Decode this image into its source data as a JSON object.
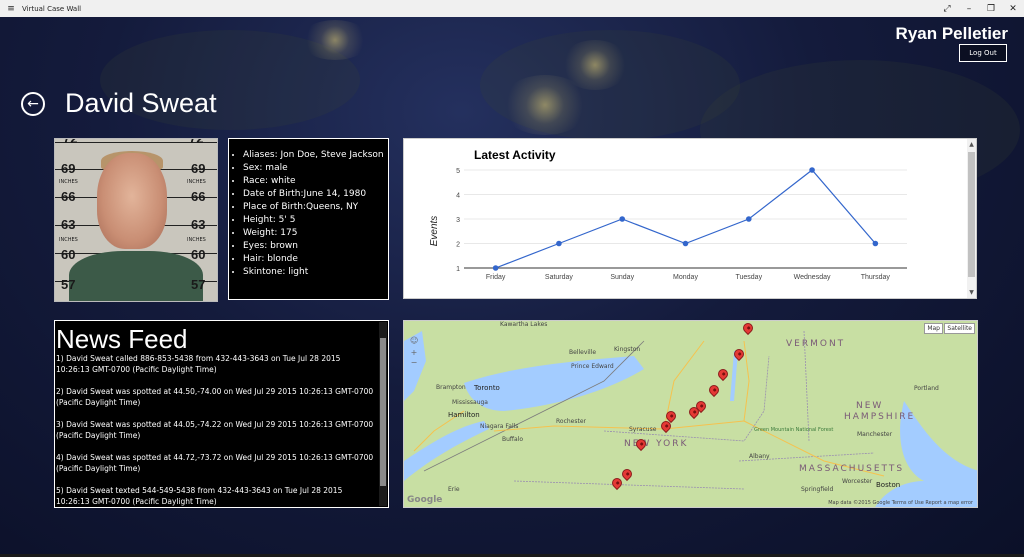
{
  "window": {
    "title": "Virtual Case Wall",
    "menu_icon": "hamburger-icon",
    "controls": [
      "expand-icon",
      "minimize-icon",
      "restore-icon",
      "close-icon"
    ]
  },
  "user": {
    "name": "Ryan Pelletier",
    "logout_label": "Log Out"
  },
  "header": {
    "back_icon": "back-arrow-icon",
    "title": "David Sweat"
  },
  "mugshot": {
    "ruler_numbers": [
      "72",
      "69",
      "66",
      "63",
      "60",
      "57"
    ],
    "ruler_sub": "INCHES"
  },
  "bio": {
    "items": [
      "Aliases: Jon Doe, Steve Jackson",
      "Sex: male",
      "Race: white",
      "Date of Birth:June 14, 1980",
      "Place of Birth:Queens, NY",
      "Height: 5' 5",
      "Weight: 175",
      "Eyes: brown",
      "Hair: blonde",
      "Skintone: light"
    ]
  },
  "chart_data": {
    "type": "line",
    "title": "Latest Activity",
    "xlabel": "",
    "ylabel": "Events",
    "categories": [
      "Friday",
      "Saturday",
      "Sunday",
      "Monday",
      "Tuesday",
      "Wednesday",
      "Thursday"
    ],
    "series": [
      {
        "values": [
          1,
          2,
          3,
          2,
          3,
          5,
          2
        ]
      }
    ],
    "ylim": [
      1,
      5
    ],
    "yticks": [
      1,
      2,
      3,
      4,
      5
    ],
    "grid": true,
    "color": "#3366cc"
  },
  "news": {
    "title": "News Feed",
    "items": [
      "1) David Sweat called 886-853-5438 from 432-443-3643 on Tue Jul 28 2015 10:26:13 GMT-0700 (Pacific Daylight Time)",
      "2) David Sweat was spotted at 44.50,-74.00 on Wed Jul 29 2015 10:26:13 GMT-0700 (Pacific Daylight Time)",
      "3) David Sweat was spotted at 44.05,-74.22 on Wed Jul 29 2015 10:26:13 GMT-0700 (Pacific Daylight Time)",
      "4) David Sweat was spotted at 44.72,-73.72 on Wed Jul 29 2015 10:26:13 GMT-0700 (Pacific Daylight Time)",
      "5) David Sweat texted 544-549-5438 from 432-443-3643 on Tue Jul 28 2015 10:26:13 GMT-0700 (Pacific Daylight Time)"
    ]
  },
  "map": {
    "map_button": "Map",
    "satellite_button": "Satellite",
    "google_logo": "Google",
    "footer": "Map data ©2015 Google   Terms of Use   Report a map error",
    "labels": {
      "kawartha": "Kawartha Lakes",
      "belleville": "Belleville",
      "prince_edward": "Prince Edward",
      "kingston": "Kingston",
      "brampton": "Brampton",
      "toronto": "Toronto",
      "mississauga": "Mississauga",
      "hamilton": "Hamilton",
      "niagara": "Niagara Falls",
      "buffalo": "Buffalo",
      "rochester": "Rochester",
      "syracuse": "Syracuse",
      "albany": "Albany",
      "erie": "Erie",
      "springfield": "Springfield",
      "worcester": "Worcester",
      "boston": "Boston",
      "manchester": "Manchester",
      "portland": "Portland",
      "green_mountain": "Green Mountain National Forest"
    },
    "region_labels": {
      "vermont": "VERMONT",
      "new_york": "NEW YORK",
      "new_hampshire_1": "NEW",
      "new_hampshire_2": "HAMPSHIRE",
      "massachusetts": "MASSACHUSETTS"
    }
  }
}
